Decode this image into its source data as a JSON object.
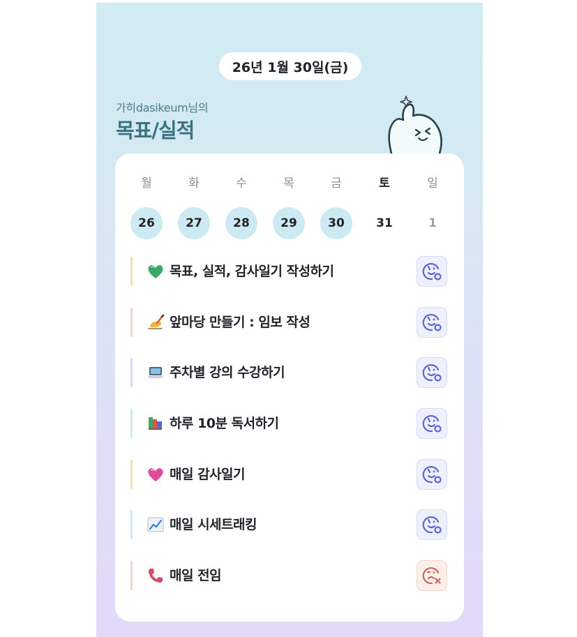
{
  "header": {
    "date": "26년 1월 30일(금)",
    "subtitle": "가히dasikeum님의",
    "title": "목표/실적"
  },
  "calendar": {
    "days": [
      {
        "label": "월",
        "num": "26",
        "state": "done"
      },
      {
        "label": "화",
        "num": "27",
        "state": "done"
      },
      {
        "label": "수",
        "num": "28",
        "state": "done"
      },
      {
        "label": "목",
        "num": "29",
        "state": "done"
      },
      {
        "label": "금",
        "num": "30",
        "state": "done"
      },
      {
        "label": "토",
        "num": "31",
        "state": "today"
      },
      {
        "label": "일",
        "num": "1",
        "state": "future"
      }
    ]
  },
  "tasks": [
    {
      "icon": "green-heart-icon",
      "label": "목표, 실적, 감사일기 작성하기",
      "bar_color": "#f4dfb0",
      "status": "smile-check"
    },
    {
      "icon": "writing-hand-icon",
      "label": "앞마당 만들기 : 임보 작성",
      "bar_color": "#f4d3d3",
      "status": "smile-check"
    },
    {
      "icon": "laptop-icon",
      "label": "주차별 강의 수강하기",
      "bar_color": "#d6d8f6",
      "status": "smile-check"
    },
    {
      "icon": "books-icon",
      "label": "하루 10분 독서하기",
      "bar_color": "#cfeedd",
      "status": "smile-check"
    },
    {
      "icon": "pink-heart-icon",
      "label": "매일 감사일기",
      "bar_color": "#f4dfb0",
      "status": "smile-check"
    },
    {
      "icon": "chart-icon",
      "label": "매일 시세트래킹",
      "bar_color": "#cdeef4",
      "status": "smile-check"
    },
    {
      "icon": "phone-icon",
      "label": "매일 전임",
      "bar_color": "#f4d3d3",
      "status": "frown-x"
    }
  ],
  "colors": {
    "accent": "#5b63d8",
    "fail": "#d0674b",
    "done_day": "#cdeaf2",
    "title": "#3a7380"
  }
}
